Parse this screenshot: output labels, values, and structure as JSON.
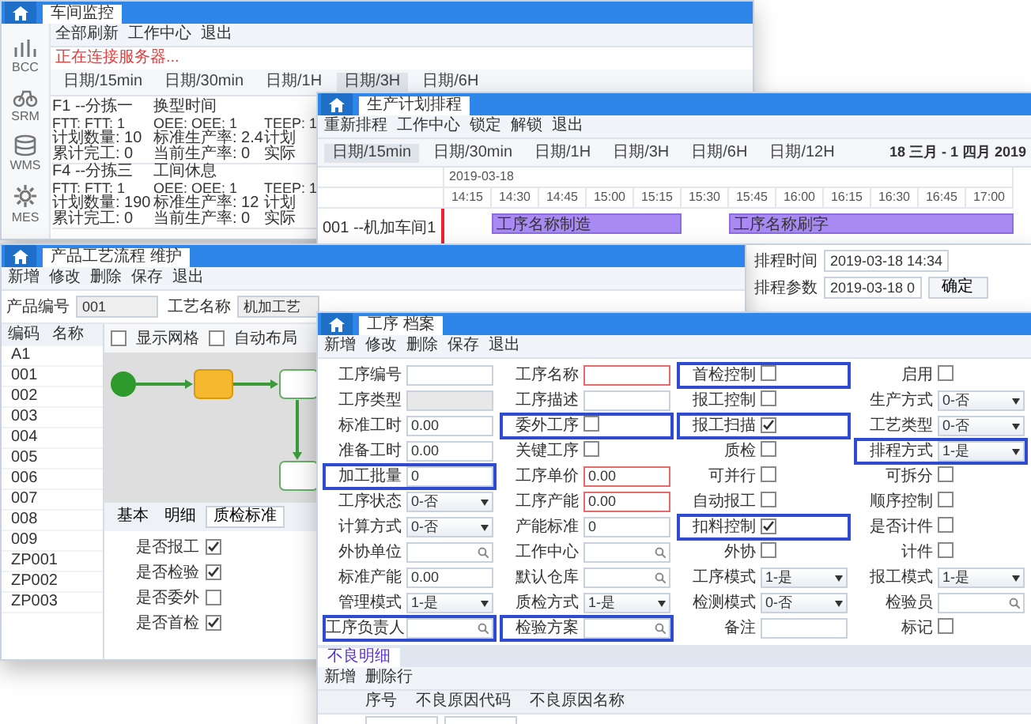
{
  "monitor_window": {
    "tab": "车间监控",
    "toolbar": [
      "全部刷新",
      "工作中心",
      "退出"
    ],
    "status": "正在连接服务器...",
    "sidebar": [
      {
        "label": "BCC",
        "kind": "chart"
      },
      {
        "label": "SRM",
        "kind": "bike"
      },
      {
        "label": "WMS",
        "kind": "database"
      },
      {
        "label": "MES",
        "kind": "gear"
      }
    ],
    "views": [
      {
        "label": "日期/15min",
        "selected": false
      },
      {
        "label": "日期/30min",
        "selected": false
      },
      {
        "label": "日期/1H",
        "selected": false
      },
      {
        "label": "日期/3H",
        "selected": true
      },
      {
        "label": "日期/6H",
        "selected": false
      }
    ],
    "cards": [
      {
        "title": "F1 --分拣一",
        "event": "换型时间",
        "lines": [
          [
            "FTT: FTT: 1",
            "OEE: OEE: 1",
            "TEEP: 1"
          ],
          [
            "计划数量: 10",
            "标准生产率: 2.4",
            "计划"
          ],
          [
            "累计完工: 0",
            "当前生产率: 0",
            "实际"
          ]
        ]
      },
      {
        "title": "F4 --分拣三",
        "event": "工间休息",
        "lines": [
          [
            "FTT: FTT: 1",
            "OEE: OEE: 1",
            "TEEP: 1"
          ],
          [
            "计划数量: 190",
            "标准生产率: 12",
            "计划"
          ],
          [
            "累计完工: 0",
            "当前生产率: 0",
            "实际"
          ]
        ]
      }
    ]
  },
  "schedule_window": {
    "tab": "生产计划排程",
    "toolbar": [
      "重新排程",
      "工作中心",
      "锁定",
      "解锁",
      "退出"
    ],
    "views": [
      {
        "label": "日期/15min",
        "selected": true
      },
      {
        "label": "日期/30min",
        "selected": false
      },
      {
        "label": "日期/1H",
        "selected": false
      },
      {
        "label": "日期/3H",
        "selected": false
      },
      {
        "label": "日期/6H",
        "selected": false
      },
      {
        "label": "日期/12H",
        "selected": false
      }
    ],
    "range": "18 三月 - 1 四月 2019",
    "date": "2019-03-18",
    "times": [
      "14:15",
      "14:30",
      "14:45",
      "15:00",
      "15:15",
      "15:30",
      "15:45",
      "16:00",
      "16:15",
      "16:30",
      "16:45",
      "17:00"
    ],
    "rows": [
      {
        "name": "001 --机加车间1",
        "tasks": [
          {
            "label": "工序名称制造"
          },
          {
            "label": "工序名称刷字"
          }
        ]
      }
    ]
  },
  "schedule_dialog": {
    "fields": [
      {
        "label": "排程时间",
        "value": "2019-03-18 14:34"
      },
      {
        "label": "排程参数",
        "value": "2019-03-18 0"
      }
    ],
    "button": "确定"
  },
  "routing_window": {
    "tab": "产品工艺流程 维护",
    "toolbar": [
      "新增",
      "修改",
      "删除",
      "保存",
      "退出"
    ],
    "fields": [
      {
        "label": "产品编号",
        "value": "001"
      },
      {
        "label": "工艺名称",
        "value": "机加工艺"
      }
    ],
    "tree_header": [
      "编码",
      "名称"
    ],
    "tree": [
      "A1",
      "001",
      "002",
      "003",
      "004",
      "005",
      "006",
      "007",
      "008",
      "009",
      "ZP001",
      "ZP002",
      "ZP003"
    ],
    "flow_options": [
      {
        "label": "显示网格",
        "checked": false
      },
      {
        "label": "自动布局",
        "checked": false
      }
    ],
    "detail_tabs": [
      {
        "label": "基本",
        "selected": false
      },
      {
        "label": "明细",
        "selected": false
      },
      {
        "label": "质检标准",
        "selected": true
      }
    ],
    "detail_checks": [
      {
        "label": "是否报工",
        "checked": true
      },
      {
        "label": "是否检验",
        "checked": true
      },
      {
        "label": "是否委外",
        "checked": false
      },
      {
        "label": "是否首检",
        "checked": true
      }
    ]
  },
  "process_window": {
    "tab": "工序 档案",
    "toolbar": [
      "新增",
      "修改",
      "删除",
      "保存",
      "退出"
    ],
    "fields": [
      {
        "label": "工序编号",
        "kind": "text",
        "required": false,
        "highlighted": false
      },
      {
        "label": "工序名称",
        "kind": "text",
        "required": true,
        "highlighted": false
      },
      {
        "label": "首检控制",
        "kind": "check",
        "checked": false,
        "highlighted": true
      },
      {
        "label": "启用",
        "kind": "check",
        "checked": false,
        "highlighted": false
      },
      {
        "label": "工序类型",
        "kind": "disabled",
        "highlighted": false
      },
      {
        "label": "工序描述",
        "kind": "text",
        "required": false,
        "highlighted": false
      },
      {
        "label": "报工控制",
        "kind": "check",
        "checked": false,
        "highlighted": false
      },
      {
        "label": "生产方式",
        "kind": "select",
        "value": "0-否",
        "highlighted": false
      },
      {
        "label": "标准工时",
        "kind": "text",
        "value": "0.00",
        "required": false,
        "highlighted": false
      },
      {
        "label": "委外工序",
        "kind": "check",
        "checked": false,
        "highlighted": true
      },
      {
        "label": "报工扫描",
        "kind": "check",
        "checked": true,
        "highlighted": true
      },
      {
        "label": "工艺类型",
        "kind": "select",
        "value": "0-否",
        "highlighted": false
      },
      {
        "label": "准备工时",
        "kind": "text",
        "value": "0.00",
        "required": false,
        "highlighted": false
      },
      {
        "label": "关键工序",
        "kind": "check",
        "checked": false,
        "highlighted": false
      },
      {
        "label": "质检",
        "kind": "check",
        "checked": false,
        "highlighted": false
      },
      {
        "label": "排程方式",
        "kind": "select",
        "value": "1-是",
        "highlighted": true
      },
      {
        "label": "加工批量",
        "kind": "text",
        "value": "0",
        "required": false,
        "highlighted": true
      },
      {
        "label": "工序单价",
        "kind": "text",
        "value": "0.00",
        "required": true,
        "highlighted": false
      },
      {
        "label": "可并行",
        "kind": "check",
        "checked": false,
        "highlighted": false
      },
      {
        "label": "可拆分",
        "kind": "check",
        "checked": false,
        "highlighted": false
      },
      {
        "label": "工序状态",
        "kind": "select",
        "value": "0-否",
        "highlighted": false
      },
      {
        "label": "工序产能",
        "kind": "text",
        "value": "0.00",
        "required": true,
        "highlighted": false
      },
      {
        "label": "自动报工",
        "kind": "check",
        "checked": false,
        "highlighted": false
      },
      {
        "label": "顺序控制",
        "kind": "check",
        "checked": false,
        "highlighted": false
      },
      {
        "label": "计算方式",
        "kind": "select",
        "value": "0-否",
        "highlighted": false
      },
      {
        "label": "产能标准",
        "kind": "text",
        "value": "0",
        "required": false,
        "highlighted": false
      },
      {
        "label": "扣料控制",
        "kind": "check",
        "checked": true,
        "highlighted": true
      },
      {
        "label": "是否计件",
        "kind": "check",
        "checked": false,
        "highlighted": false
      },
      {
        "label": "外协单位",
        "kind": "search",
        "highlighted": false
      },
      {
        "label": "工作中心",
        "kind": "search",
        "highlighted": false
      },
      {
        "label": "外协",
        "kind": "check",
        "checked": false,
        "highlighted": false
      },
      {
        "label": "计件",
        "kind": "check",
        "checked": false,
        "highlighted": false
      },
      {
        "label": "标准产能",
        "kind": "text",
        "value": "0.00",
        "required": false,
        "highlighted": false
      },
      {
        "label": "默认仓库",
        "kind": "search",
        "highlighted": false
      },
      {
        "label": "工序模式",
        "kind": "select",
        "value": "1-是",
        "highlighted": false
      },
      {
        "label": "报工模式",
        "kind": "select",
        "value": "1-是",
        "highlighted": false
      },
      {
        "label": "管理模式",
        "kind": "select",
        "value": "1-是",
        "highlighted": false
      },
      {
        "label": "质检方式",
        "kind": "select",
        "value": "1-是",
        "highlighted": false
      },
      {
        "label": "检测模式",
        "kind": "select",
        "value": "0-否",
        "highlighted": false
      },
      {
        "label": "检验员",
        "kind": "search",
        "highlighted": false
      },
      {
        "label": "工序负责人",
        "kind": "search",
        "highlighted": true
      },
      {
        "label": "检验方案",
        "kind": "search",
        "highlighted": true
      },
      {
        "label": "备注",
        "kind": "text",
        "required": false,
        "highlighted": false
      },
      {
        "label": "标记",
        "kind": "check",
        "checked": false,
        "highlighted": false
      }
    ],
    "subtab": "不良明细",
    "subtoolbar": [
      "新增",
      "删除行"
    ],
    "columns": [
      "序号",
      "不良原因代码",
      "不良原因名称"
    ]
  }
}
